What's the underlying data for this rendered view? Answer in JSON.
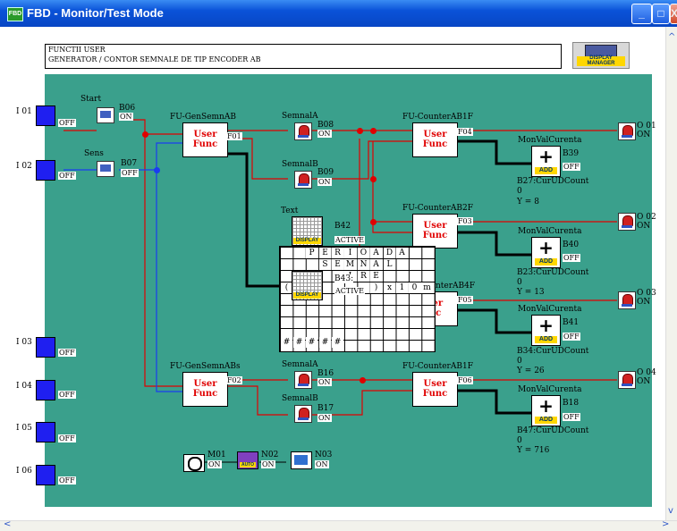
{
  "window": {
    "title": "FBD - Monitor/Test Mode",
    "app_icon": "FBD",
    "minimize": "_",
    "maximize": "□",
    "close": "X"
  },
  "description": {
    "line1": "FUNCTII USER",
    "line2": "GENERATOR / CONTOR SEMNALE DE TIP ENCODER AB"
  },
  "display_manager": {
    "label1": "DISPLAY",
    "label2": "MANAGER"
  },
  "inputs": [
    {
      "id": "I 01",
      "state": "OFF"
    },
    {
      "id": "I 02",
      "state": "OFF"
    },
    {
      "id": "I 03",
      "state": "OFF"
    },
    {
      "id": "I 04",
      "state": "OFF"
    },
    {
      "id": "I 05",
      "state": "OFF"
    },
    {
      "id": "I 06",
      "state": "OFF"
    }
  ],
  "switches": [
    {
      "name": "Start",
      "id": "B06",
      "state": "ON"
    },
    {
      "name": "Sens",
      "id": "B07",
      "state": "OFF"
    }
  ],
  "user_funcs": [
    {
      "name": "FU-GenSemnAB",
      "id": "F01",
      "line1": "User",
      "line2": "Func"
    },
    {
      "name": "FU-GenSemnABs",
      "id": "F02",
      "line1": "User",
      "line2": "Func"
    },
    {
      "name": "FU-CounterAB1F",
      "id": "F04",
      "line1": "User",
      "line2": "Func"
    },
    {
      "name": "FU-CounterAB2F",
      "id": "F03",
      "line1": "User",
      "line2": "Func"
    },
    {
      "name": "nterAB4F",
      "id": "F05",
      "line1": "ser",
      "line2": "nc"
    },
    {
      "name": "FU-CounterAB1F",
      "id": "F06",
      "line1": "User",
      "line2": "Func"
    }
  ],
  "lamps": [
    {
      "name": "SemnalA",
      "id": "B08",
      "state": "ON"
    },
    {
      "name": "SemnalB",
      "id": "B09",
      "state": "ON"
    },
    {
      "name": "SemnalA",
      "id": "B16",
      "state": "ON"
    },
    {
      "name": "SemnalB",
      "id": "B17",
      "state": "ON"
    }
  ],
  "monitors": [
    {
      "name": "MonValCurenta",
      "id": "B39",
      "state": "OFF",
      "counter": "B27:CurUDCount",
      "zero": "0",
      "value": "Y = 8"
    },
    {
      "name": "MonValCurenta",
      "id": "B40",
      "state": "OFF",
      "counter": "B23:CurUDCount",
      "zero": "0",
      "value": "Y = 13"
    },
    {
      "name": "MonValCurenta",
      "id": "B41",
      "state": "OFF",
      "counter": "B34:CurUDCount",
      "zero": "0",
      "value": "Y = 26"
    },
    {
      "name": "MonValCurenta",
      "id": "B18",
      "state": "OFF",
      "counter": "B47:CurUDCount",
      "zero": "0",
      "value": "Y = 716"
    }
  ],
  "add_label": "ADD",
  "outputs": [
    {
      "id": "O 01",
      "state": "ON"
    },
    {
      "id": "O 02",
      "state": "ON"
    },
    {
      "id": "O 03",
      "state": "ON"
    },
    {
      "id": "O 04",
      "state": "ON"
    }
  ],
  "text_blocks": [
    {
      "name": "Text",
      "id": "B42",
      "state": "ACTIVE",
      "tag": "DISPLAY"
    },
    {
      "id": "B43:",
      "state": "ACTIVE",
      "tag": "DISPLAY"
    }
  ],
  "display_rows": [
    [
      "P",
      "E",
      "R",
      "I",
      "O",
      "A",
      "D",
      "A"
    ],
    [
      "S",
      "E",
      "M",
      "N",
      "A",
      "L"
    ],
    [
      "I",
      "R",
      "E"
    ],
    [
      "(",
      ")",
      "x",
      "1",
      "0",
      "m"
    ],
    [
      "#",
      "#",
      "#",
      "#",
      "#"
    ]
  ],
  "misc": [
    {
      "id": "M01",
      "state": "ON"
    },
    {
      "id": "N02",
      "state": "ON",
      "tag": "AUTO"
    },
    {
      "id": "N03",
      "state": "ON"
    }
  ],
  "colors": {
    "canvas": "#3aa08c",
    "wire_red": "#e00000",
    "wire_blue": "#1a3cf0",
    "input_block": "#1f1ff0"
  }
}
